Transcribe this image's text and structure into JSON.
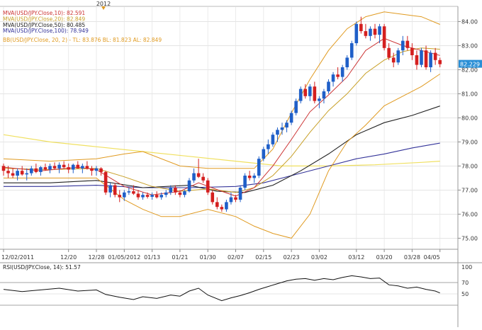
{
  "chart_data": [
    {
      "type": "candlestick",
      "top_marker": "2012",
      "ylim": [
        74.6,
        84.6
      ],
      "ticks_y": [
        75.0,
        76.0,
        77.0,
        78.0,
        79.0,
        80.0,
        81.0,
        82.0,
        83.0,
        84.0
      ],
      "x_ticks": [
        "12/02/2011",
        "12/20",
        "12/28",
        "01/05/2012",
        "01/13",
        "01/21",
        "01/30",
        "02/07",
        "02/15",
        "02/23",
        "03/02",
        "03/12",
        "03/20",
        "03/28",
        "04/05"
      ],
      "x_tick_index": [
        0,
        14,
        20,
        26,
        32,
        38,
        44,
        50,
        56,
        62,
        68,
        76,
        82,
        88,
        94
      ],
      "last_price_label": "82.229",
      "last_price": 82.229,
      "legend": [
        {
          "text": "MVA(USD/JPY.Close,10): 82.591",
          "color": "#cc3333"
        },
        {
          "text": "MVA(USD/JPY.Close,20): 82.849",
          "color": "#c8a028"
        },
        {
          "text": "MVA(USD/JPY.Close,50): 80.485",
          "color": "#222222"
        },
        {
          "text": "MVA(USD/JPY.Close,100): 78.949",
          "color": "#333399"
        },
        {
          "text": "BB(USD/JPY.Close, 20, 2) -  TL: 83.876  BL: 81.823  AL: 82.849",
          "color": "#e09a20"
        }
      ],
      "candles": [
        [
          78.0,
          78.1,
          77.6,
          77.8
        ],
        [
          77.8,
          78.0,
          77.5,
          77.7
        ],
        [
          77.7,
          77.9,
          77.5,
          77.6
        ],
        [
          77.6,
          77.9,
          77.4,
          77.8
        ],
        [
          77.8,
          78.0,
          77.6,
          77.65
        ],
        [
          77.65,
          77.9,
          77.4,
          77.7
        ],
        [
          77.7,
          78.0,
          77.6,
          77.9
        ],
        [
          77.9,
          78.1,
          77.7,
          77.75
        ],
        [
          77.75,
          78.0,
          77.6,
          77.95
        ],
        [
          77.95,
          78.1,
          77.8,
          77.85
        ],
        [
          77.85,
          78.1,
          77.7,
          78.0
        ],
        [
          78.0,
          78.15,
          77.85,
          77.9
        ],
        [
          77.9,
          78.15,
          77.7,
          78.05
        ],
        [
          78.05,
          78.2,
          77.9,
          77.95
        ],
        [
          77.95,
          78.1,
          77.7,
          77.85
        ],
        [
          77.85,
          78.1,
          77.7,
          78.05
        ],
        [
          78.05,
          78.2,
          77.9,
          77.9
        ],
        [
          77.9,
          78.1,
          77.7,
          78.0
        ],
        [
          78.0,
          78.2,
          77.85,
          77.9
        ],
        [
          77.9,
          78.0,
          77.6,
          77.8
        ],
        [
          77.8,
          78.0,
          77.6,
          77.9
        ],
        [
          77.9,
          77.95,
          77.6,
          77.75
        ],
        [
          77.75,
          77.8,
          76.8,
          76.9
        ],
        [
          76.9,
          77.3,
          76.7,
          77.2
        ],
        [
          77.2,
          77.3,
          76.7,
          76.8
        ],
        [
          76.8,
          77.0,
          76.5,
          76.7
        ],
        [
          76.7,
          77.0,
          76.55,
          76.9
        ],
        [
          76.9,
          77.1,
          76.8,
          76.95
        ],
        [
          76.95,
          77.2,
          76.8,
          76.85
        ],
        [
          76.85,
          77.0,
          76.6,
          76.7
        ],
        [
          76.7,
          76.9,
          76.6,
          76.8
        ],
        [
          76.8,
          76.9,
          76.65,
          76.72
        ],
        [
          76.72,
          76.9,
          76.6,
          76.8
        ],
        [
          76.8,
          76.95,
          76.65,
          76.7
        ],
        [
          76.7,
          76.9,
          76.6,
          76.8
        ],
        [
          76.8,
          77.0,
          76.7,
          76.9
        ],
        [
          76.9,
          77.2,
          76.8,
          77.1
        ],
        [
          77.1,
          77.2,
          76.8,
          76.9
        ],
        [
          76.9,
          77.0,
          76.7,
          76.8
        ],
        [
          76.8,
          77.0,
          76.7,
          76.95
        ],
        [
          76.95,
          77.5,
          76.9,
          77.4
        ],
        [
          77.4,
          77.9,
          77.3,
          77.7
        ],
        [
          77.7,
          78.3,
          77.5,
          77.55
        ],
        [
          77.55,
          77.7,
          77.3,
          77.4
        ],
        [
          77.4,
          77.5,
          76.8,
          76.9
        ],
        [
          76.9,
          77.0,
          76.4,
          76.5
        ],
        [
          76.5,
          76.7,
          76.2,
          76.3
        ],
        [
          76.3,
          76.4,
          76.1,
          76.2
        ],
        [
          76.2,
          76.6,
          76.1,
          76.5
        ],
        [
          76.5,
          76.9,
          76.4,
          76.7
        ],
        [
          76.7,
          76.8,
          76.5,
          76.6
        ],
        [
          76.6,
          77.2,
          76.5,
          77.1
        ],
        [
          77.1,
          77.7,
          77.0,
          77.6
        ],
        [
          77.6,
          77.8,
          77.4,
          77.5
        ],
        [
          77.5,
          77.7,
          77.3,
          77.6
        ],
        [
          77.6,
          78.4,
          77.5,
          78.3
        ],
        [
          78.3,
          78.8,
          78.2,
          78.7
        ],
        [
          78.7,
          79.1,
          78.5,
          78.9
        ],
        [
          78.9,
          79.4,
          78.8,
          79.3
        ],
        [
          79.3,
          79.6,
          79.0,
          79.5
        ],
        [
          79.5,
          79.8,
          79.3,
          79.6
        ],
        [
          79.6,
          79.9,
          79.4,
          79.8
        ],
        [
          79.8,
          80.3,
          79.7,
          80.2
        ],
        [
          80.2,
          80.8,
          80.1,
          80.7
        ],
        [
          80.7,
          81.3,
          80.6,
          81.2
        ],
        [
          81.2,
          81.4,
          80.8,
          80.9
        ],
        [
          80.9,
          81.4,
          80.7,
          81.3
        ],
        [
          81.3,
          81.5,
          80.6,
          80.7
        ],
        [
          80.7,
          80.9,
          80.4,
          80.8
        ],
        [
          80.8,
          81.2,
          80.6,
          81.1
        ],
        [
          81.1,
          81.6,
          81.0,
          81.5
        ],
        [
          81.5,
          81.9,
          81.3,
          81.8
        ],
        [
          81.8,
          82.1,
          81.6,
          81.7
        ],
        [
          81.7,
          82.2,
          81.5,
          82.1
        ],
        [
          82.1,
          82.6,
          82.0,
          82.5
        ],
        [
          82.5,
          83.2,
          82.4,
          83.1
        ],
        [
          83.1,
          84.0,
          83.0,
          83.9
        ],
        [
          83.9,
          84.2,
          83.5,
          83.6
        ],
        [
          83.6,
          83.9,
          83.3,
          83.4
        ],
        [
          83.4,
          83.8,
          83.2,
          83.7
        ],
        [
          83.7,
          83.9,
          83.3,
          83.45
        ],
        [
          83.45,
          83.9,
          83.1,
          83.8
        ],
        [
          83.8,
          83.9,
          82.8,
          82.9
        ],
        [
          82.9,
          83.1,
          82.4,
          82.5
        ],
        [
          82.5,
          82.7,
          82.1,
          82.3
        ],
        [
          82.3,
          82.9,
          82.2,
          82.8
        ],
        [
          82.8,
          83.4,
          82.6,
          83.2
        ],
        [
          83.2,
          83.4,
          82.8,
          82.9
        ],
        [
          82.9,
          83.1,
          82.4,
          82.6
        ],
        [
          82.6,
          82.8,
          82.0,
          82.2
        ],
        [
          82.2,
          82.9,
          82.1,
          82.8
        ],
        [
          82.8,
          83.0,
          82.0,
          82.1
        ],
        [
          82.1,
          82.8,
          81.9,
          82.7
        ],
        [
          82.7,
          82.9,
          82.2,
          82.4
        ],
        [
          82.4,
          82.5,
          82.1,
          82.229
        ]
      ],
      "ma10": [
        [
          0,
          77.95
        ],
        [
          8,
          77.8
        ],
        [
          16,
          77.95
        ],
        [
          20,
          77.85
        ],
        [
          26,
          77.15
        ],
        [
          32,
          76.8
        ],
        [
          38,
          76.95
        ],
        [
          42,
          77.3
        ],
        [
          47,
          76.95
        ],
        [
          50,
          76.75
        ],
        [
          54,
          77.1
        ],
        [
          58,
          78.0
        ],
        [
          62,
          79.1
        ],
        [
          66,
          80.25
        ],
        [
          70,
          80.95
        ],
        [
          74,
          81.7
        ],
        [
          78,
          82.8
        ],
        [
          82,
          83.3
        ],
        [
          86,
          83.0
        ],
        [
          90,
          82.8
        ],
        [
          94,
          82.59
        ]
      ],
      "ma20": [
        [
          0,
          77.9
        ],
        [
          10,
          77.85
        ],
        [
          20,
          77.9
        ],
        [
          26,
          77.55
        ],
        [
          32,
          77.15
        ],
        [
          38,
          76.95
        ],
        [
          44,
          77.05
        ],
        [
          50,
          76.9
        ],
        [
          54,
          77.1
        ],
        [
          58,
          77.6
        ],
        [
          62,
          78.4
        ],
        [
          66,
          79.4
        ],
        [
          70,
          80.3
        ],
        [
          74,
          81.0
        ],
        [
          78,
          81.85
        ],
        [
          82,
          82.4
        ],
        [
          86,
          82.75
        ],
        [
          90,
          82.9
        ],
        [
          94,
          82.85
        ]
      ],
      "bb_upper": [
        [
          0,
          78.3
        ],
        [
          10,
          78.2
        ],
        [
          20,
          78.3
        ],
        [
          26,
          78.5
        ],
        [
          30,
          78.6
        ],
        [
          38,
          78.0
        ],
        [
          44,
          77.9
        ],
        [
          50,
          77.9
        ],
        [
          54,
          77.9
        ],
        [
          58,
          78.7
        ],
        [
          62,
          80.2
        ],
        [
          66,
          81.6
        ],
        [
          70,
          82.8
        ],
        [
          74,
          83.7
        ],
        [
          78,
          84.2
        ],
        [
          82,
          84.4
        ],
        [
          86,
          84.3
        ],
        [
          90,
          84.2
        ],
        [
          94,
          83.88
        ]
      ],
      "bb_lower": [
        [
          0,
          77.5
        ],
        [
          10,
          77.5
        ],
        [
          20,
          77.5
        ],
        [
          26,
          76.6
        ],
        [
          30,
          76.2
        ],
        [
          34,
          75.9
        ],
        [
          38,
          75.9
        ],
        [
          44,
          76.2
        ],
        [
          50,
          75.9
        ],
        [
          54,
          75.5
        ],
        [
          58,
          75.2
        ],
        [
          62,
          75.0
        ],
        [
          66,
          76.0
        ],
        [
          70,
          77.8
        ],
        [
          74,
          79.0
        ],
        [
          78,
          79.7
        ],
        [
          82,
          80.5
        ],
        [
          86,
          80.9
        ],
        [
          90,
          81.3
        ],
        [
          94,
          81.82
        ]
      ],
      "ma50": [
        [
          0,
          77.3
        ],
        [
          10,
          77.3
        ],
        [
          20,
          77.4
        ],
        [
          30,
          77.1
        ],
        [
          40,
          77.2
        ],
        [
          46,
          76.95
        ],
        [
          52,
          76.9
        ],
        [
          58,
          77.2
        ],
        [
          64,
          77.8
        ],
        [
          70,
          78.5
        ],
        [
          76,
          79.3
        ],
        [
          82,
          79.8
        ],
        [
          88,
          80.1
        ],
        [
          94,
          80.49
        ]
      ],
      "ma100": [
        [
          0,
          77.15
        ],
        [
          10,
          77.15
        ],
        [
          20,
          77.2
        ],
        [
          30,
          77.1
        ],
        [
          40,
          77.1
        ],
        [
          50,
          77.15
        ],
        [
          56,
          77.3
        ],
        [
          62,
          77.6
        ],
        [
          70,
          78.0
        ],
        [
          76,
          78.3
        ],
        [
          82,
          78.5
        ],
        [
          88,
          78.75
        ],
        [
          94,
          78.95
        ]
      ],
      "ma200": [
        [
          0,
          79.3
        ],
        [
          10,
          79.0
        ],
        [
          20,
          78.8
        ],
        [
          30,
          78.6
        ],
        [
          40,
          78.4
        ],
        [
          50,
          78.2
        ],
        [
          60,
          78.0
        ],
        [
          70,
          78.0
        ],
        [
          80,
          78.05
        ],
        [
          90,
          78.15
        ],
        [
          94,
          78.2
        ]
      ]
    },
    {
      "type": "line",
      "legend": "RSI(USD/JPY.Close, 14): 51.57",
      "ylim": [
        0,
        100
      ],
      "ticks_y": [
        50,
        70,
        100
      ],
      "levels": [
        30,
        70
      ],
      "values": [
        [
          0,
          58
        ],
        [
          4,
          54
        ],
        [
          8,
          57
        ],
        [
          12,
          60
        ],
        [
          16,
          55
        ],
        [
          20,
          57
        ],
        [
          22,
          49
        ],
        [
          25,
          44
        ],
        [
          28,
          40
        ],
        [
          30,
          45
        ],
        [
          33,
          42
        ],
        [
          36,
          48
        ],
        [
          38,
          46
        ],
        [
          40,
          55
        ],
        [
          42,
          60
        ],
        [
          44,
          48
        ],
        [
          47,
          38
        ],
        [
          49,
          43
        ],
        [
          51,
          47
        ],
        [
          53,
          52
        ],
        [
          55,
          58
        ],
        [
          57,
          63
        ],
        [
          59,
          68
        ],
        [
          61,
          73
        ],
        [
          63,
          76
        ],
        [
          65,
          77
        ],
        [
          67,
          74
        ],
        [
          69,
          77
        ],
        [
          71,
          75
        ],
        [
          73,
          79
        ],
        [
          75,
          82
        ],
        [
          77,
          80
        ],
        [
          79,
          77
        ],
        [
          81,
          78
        ],
        [
          83,
          66
        ],
        [
          85,
          64
        ],
        [
          87,
          60
        ],
        [
          89,
          62
        ],
        [
          91,
          58
        ],
        [
          93,
          55
        ],
        [
          94,
          51.6
        ]
      ]
    }
  ]
}
